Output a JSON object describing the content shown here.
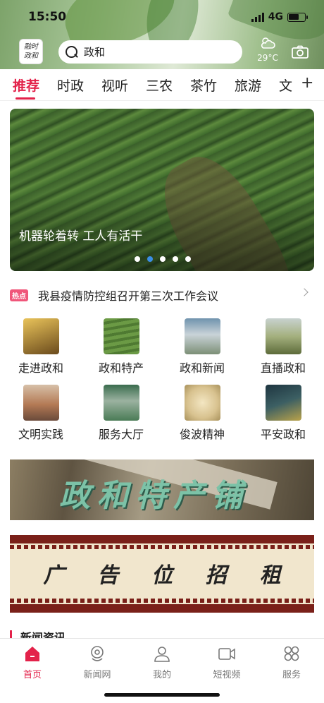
{
  "status_bar": {
    "time": "15:50",
    "network": "4G"
  },
  "header": {
    "logo_line1": "政和",
    "logo_line2": "融时",
    "search_value": "政和",
    "weather_temp": "29°C"
  },
  "tabs": [
    {
      "label": "推荐"
    },
    {
      "label": "时政"
    },
    {
      "label": "视听"
    },
    {
      "label": "三农"
    },
    {
      "label": "茶竹"
    },
    {
      "label": "旅游"
    },
    {
      "label": "文"
    }
  ],
  "tab_add_label": "+",
  "banner": {
    "caption": "机器轮着转 工人有活干",
    "slide_count": 5,
    "active_slide": 2
  },
  "hot": {
    "badge": "热点",
    "text": "我县疫情防控组召开第三次工作会议"
  },
  "grid": [
    {
      "label": "走进政和",
      "color": "#b8842c"
    },
    {
      "label": "政和特产",
      "color": "#5d8a3b"
    },
    {
      "label": "政和新闻",
      "color": "#8ea3b0"
    },
    {
      "label": "直播政和",
      "color": "#7d8c5a"
    },
    {
      "label": "文明实践",
      "color": "#b47a55"
    },
    {
      "label": "服务大厅",
      "color": "#4a7b56"
    },
    {
      "label": "俊波精神",
      "color": "#d8c28f"
    },
    {
      "label": "平安政和",
      "color": "#3c5f63"
    }
  ],
  "ad1_text": "政和特产铺",
  "ad2_chars": [
    "广",
    "告",
    "位",
    "招",
    "租"
  ],
  "section_title": "新闻资讯",
  "bottom_nav": [
    {
      "label": "首页",
      "icon": "home-icon"
    },
    {
      "label": "新闻网",
      "icon": "news-network-icon"
    },
    {
      "label": "我的",
      "icon": "user-icon"
    },
    {
      "label": "短视频",
      "icon": "video-icon"
    },
    {
      "label": "服务",
      "icon": "grid-icon"
    }
  ],
  "colors": {
    "accent": "#e3224a",
    "dot_active": "#3a8ee6",
    "hot_badge": "#f0567a"
  }
}
